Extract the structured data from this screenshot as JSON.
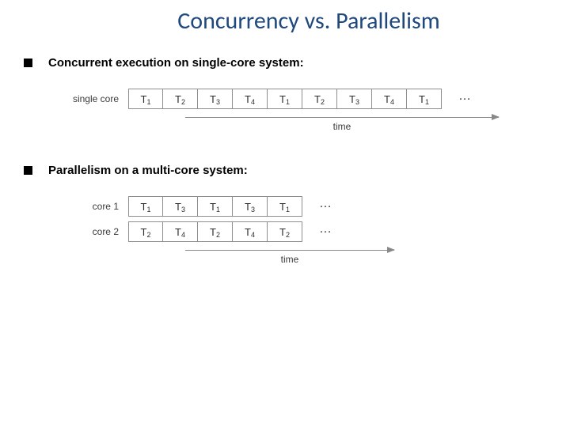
{
  "title": "Concurrency vs. Parallelism",
  "bullets": {
    "b1": "Concurrent execution on single-core system:",
    "b2": "Parallelism on a multi-core system:"
  },
  "single": {
    "label": "single core",
    "cells": [
      "T1",
      "T2",
      "T3",
      "T4",
      "T1",
      "T2",
      "T3",
      "T4",
      "T1"
    ],
    "ellipsis": "…",
    "time": "time"
  },
  "multi": {
    "row1_label": "core 1",
    "row2_label": "core 2",
    "row1_cells": [
      "T1",
      "T3",
      "T1",
      "T3",
      "T1"
    ],
    "row2_cells": [
      "T2",
      "T4",
      "T2",
      "T4",
      "T2"
    ],
    "ellipsis": "…",
    "time": "time"
  }
}
